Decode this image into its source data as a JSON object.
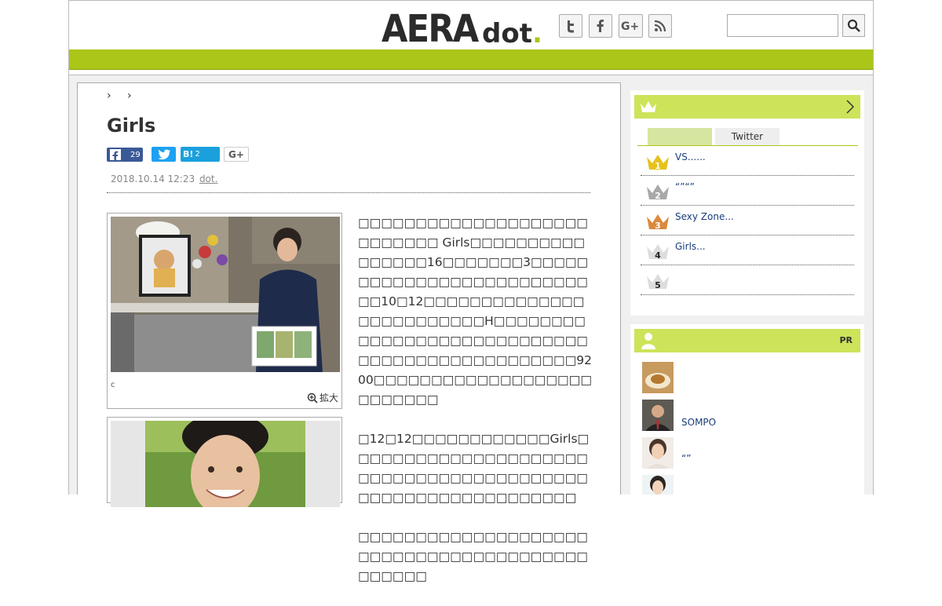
{
  "header": {
    "logo_main": "AERA",
    "logo_sub": "dot",
    "logo_period": ".",
    "social": [
      {
        "name": "twitter-icon",
        "glyph": "t"
      },
      {
        "name": "facebook-icon",
        "glyph": "f"
      },
      {
        "name": "googleplus-icon",
        "glyph": "G+"
      },
      {
        "name": "rss-icon",
        "glyph": "rss"
      }
    ],
    "search_placeholder": ""
  },
  "article": {
    "breadcrumb_sep": "› ›",
    "title": "Girls",
    "share": {
      "facebook_count": "29",
      "hatena_label": "B!",
      "hatena_count": "2",
      "googleplus": "G+"
    },
    "date": "2018.10.14 12:23",
    "source": "dot.",
    "photo_caption": "c",
    "zoom_label": "拡大",
    "paragraphs": [
      "□□□□□□□□□□□□□□□□□□□□□□□□□□□ Girls□□□□□□□□□□□□□□□□16□□□□□□□3□□□□□□□□□□□□□□□□□□□□□□□□□□□10□12□□□□□□□□□□□□□□□□□□□□□□□□□H□□□□□□□□□□□□□□□□□□□□□□□□□□□□□□□□□□□□□□□□□□□□□□□9200□□□□□□□□□□□□□□□□□□□□□□□□□□",
      "□12□12□□□□□□□□□□□□Girls□□□□□□□□□□□□□□□□□□□□□□□□□□□□□□□□□□□□□□□□□□□□□□□□□□□□□□□□□□□□",
      "□□□□□□□□□□□□□□□□□□□□□□□□□□□□□□□□□□□□□□□□□□□□□□"
    ]
  },
  "ranking": {
    "tab_left": "",
    "tab_right": "Twitter",
    "items": [
      {
        "rank": "1",
        "label": "VS......",
        "color": "#e6c21a"
      },
      {
        "rank": "2",
        "label": "“”“”",
        "color": "#a8a8a8"
      },
      {
        "rank": "3",
        "label": "Sexy Zone...",
        "color": "#d98a3c"
      },
      {
        "rank": "4",
        "label": "Girls...",
        "color": "#dddddd"
      },
      {
        "rank": "5",
        "label": "",
        "color": "#dddddd"
      }
    ]
  },
  "pr": {
    "label": "PR",
    "items": [
      {
        "label": ""
      },
      {
        "label": "SOMPO"
      },
      {
        "label": "“”"
      },
      {
        "label": ""
      }
    ]
  }
}
